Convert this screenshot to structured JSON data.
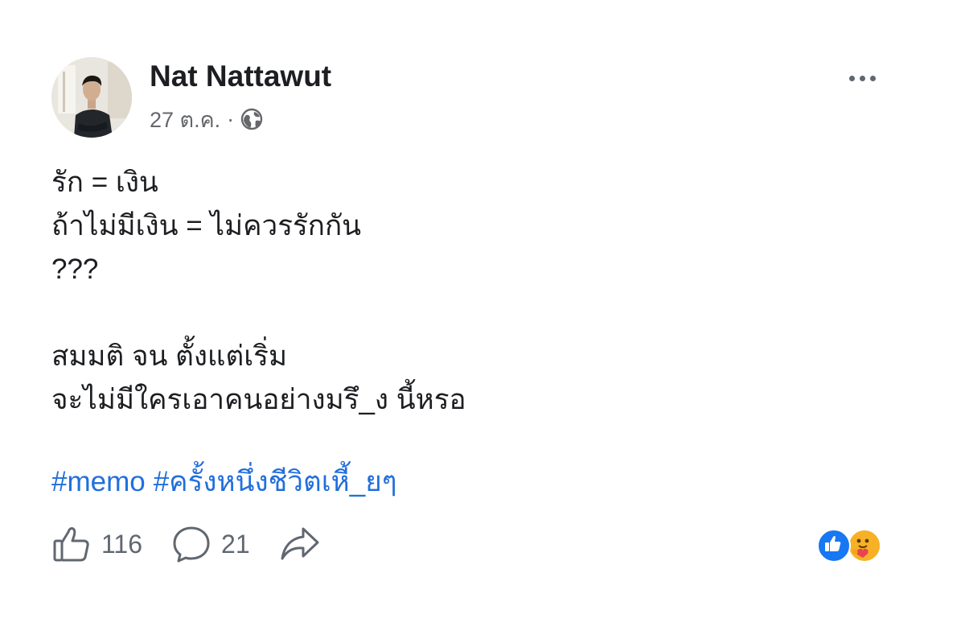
{
  "post": {
    "author": "Nat Nattawut",
    "date": "27 ต.ค.",
    "separator": "·",
    "audience_icon": "globe-icon",
    "menu_icon": "more-options-icon",
    "body_lines": [
      "รัก = เงิน",
      "ถ้าไม่มีเงิน = ไม่ควรรักกัน",
      "???",
      "",
      "สมมติ จน ตั้งแต่เริ่ม",
      "จะไม่มีใครเอาคนอย่างมรึ_ง นี้หรอ"
    ],
    "hashtags": [
      "#memo",
      "#ครั้งหนึ่งชีวิตเหี้_ยๆ"
    ],
    "likes_count": "116",
    "comments_count": "21",
    "reaction_icons": [
      "like-reaction-icon",
      "care-reaction-icon"
    ]
  },
  "colors": {
    "hashtag": "#216fdb",
    "text": "#1c1e21",
    "secondary": "#65676b",
    "like_blue": "#1877f2",
    "care_yellow": "#f7b125"
  }
}
